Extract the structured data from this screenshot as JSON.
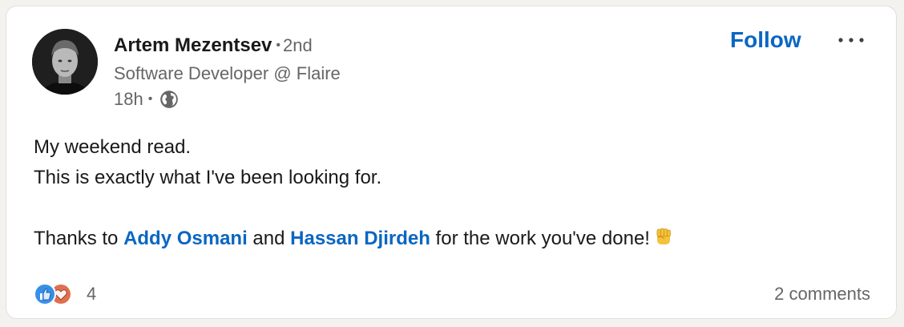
{
  "author": {
    "name": "Artem Mezentsev",
    "separator": "•",
    "degree": "2nd",
    "headline": "Software Developer @ Flaire",
    "time": "18h",
    "visibility_icon": "globe-icon"
  },
  "actions": {
    "follow_label": "Follow",
    "more_icon": "more-horizontal-icon"
  },
  "post": {
    "line1": "My weekend read.",
    "line2": "This is exactly what I've been looking for.",
    "thanks_prefix": "Thanks to ",
    "mention1": "Addy Osmani",
    "connector": " and ",
    "mention2": "Hassan Djirdeh",
    "thanks_suffix": " for the work you've done!",
    "emoji": "raised-fist-emoji"
  },
  "social": {
    "reaction_icons": [
      "like-icon",
      "love-icon"
    ],
    "reaction_count": "4",
    "comments": "2 comments"
  },
  "colors": {
    "link": "#0a66c2",
    "secondary_text": "#666666",
    "like": "#378fe9",
    "love": "#df704d"
  }
}
